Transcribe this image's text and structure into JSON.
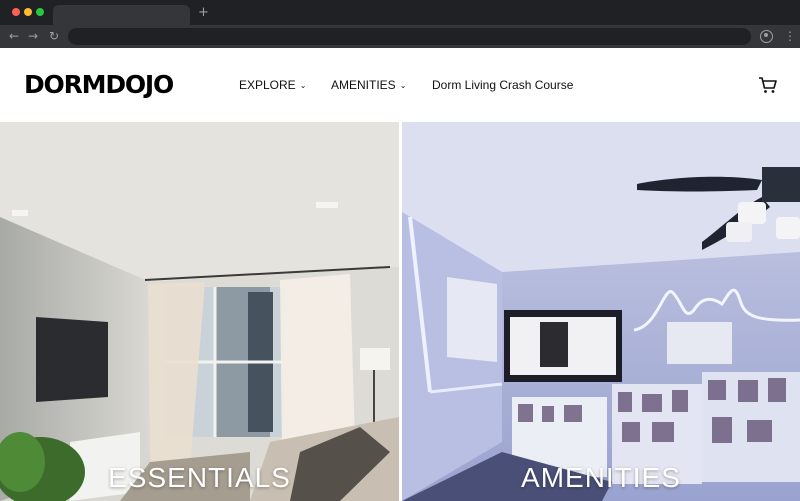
{
  "browser": {
    "new_tab_glyph": "+",
    "back_glyph": "←",
    "forward_glyph": "→",
    "reload_glyph": "↻",
    "menu_glyph": "⋮"
  },
  "site": {
    "logo": "DORMDOJO",
    "nav": [
      {
        "label": "EXPLORE",
        "has_dropdown": true
      },
      {
        "label": "AMENITIES",
        "has_dropdown": true
      },
      {
        "label": "Dorm Living Crash Course",
        "has_dropdown": false
      }
    ],
    "chevron_glyph": "⌄",
    "cart_icon": "cart-icon"
  },
  "hero": {
    "left_label": "ESSENTIALS",
    "right_label": "AMENITIES"
  },
  "colors": {
    "chrome_bg": "#202124",
    "toolbar_bg": "#35363a",
    "header_bg": "#ffffff",
    "neon_accent": "#9db0ff"
  }
}
